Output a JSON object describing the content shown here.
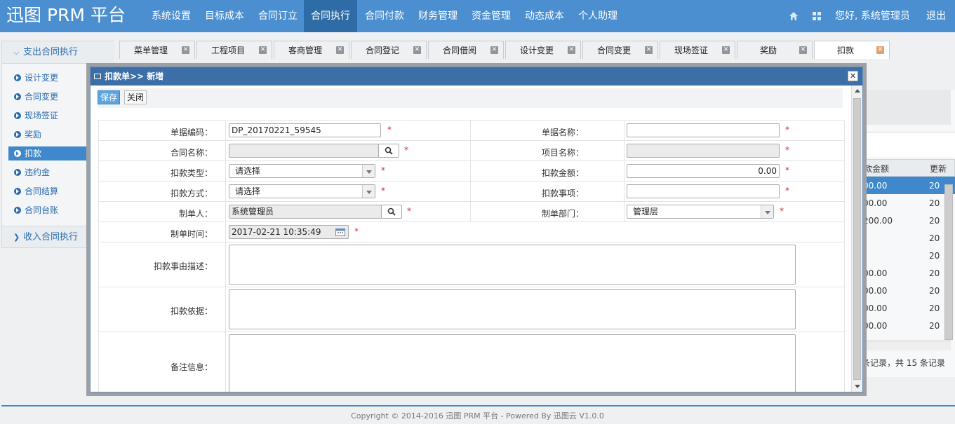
{
  "app": {
    "title": "迅图 PRM 平台"
  },
  "nav": {
    "items": [
      {
        "label": "系统设置"
      },
      {
        "label": "目标成本"
      },
      {
        "label": "合同订立"
      },
      {
        "label": "合同执行"
      },
      {
        "label": "合同付款"
      },
      {
        "label": "财务管理"
      },
      {
        "label": "资金管理"
      },
      {
        "label": "动态成本"
      },
      {
        "label": "个人助理"
      }
    ],
    "active": "合同执行",
    "greeting": "您好, 系统管理员",
    "logout": "退出"
  },
  "sidebar": {
    "group_label": "支出合同执行",
    "items": [
      {
        "label": "设计变更"
      },
      {
        "label": "合同变更"
      },
      {
        "label": "现场签证"
      },
      {
        "label": "奖励"
      },
      {
        "label": "扣款"
      },
      {
        "label": "违约金"
      },
      {
        "label": "合同结算"
      },
      {
        "label": "合同台账"
      }
    ],
    "active_item": "扣款",
    "income_label": "收入合同执行"
  },
  "tabs": [
    {
      "label": "菜单管理"
    },
    {
      "label": "工程项目"
    },
    {
      "label": "客商管理"
    },
    {
      "label": "合同登记"
    },
    {
      "label": "合同借阅"
    },
    {
      "label": "设计变更"
    },
    {
      "label": "合同变更"
    },
    {
      "label": "现场签证"
    },
    {
      "label": "奖励"
    },
    {
      "label": "扣款"
    }
  ],
  "background_grid": {
    "header_partial": "款金额",
    "header_next": "更新时",
    "rows": [
      {
        "amount": "00.00",
        "date": "20"
      },
      {
        "amount": "00.00",
        "date": "20"
      },
      {
        "amount": "200.00",
        "date": "20"
      },
      {
        "amount": "",
        "date": "20"
      },
      {
        "amount": "",
        "date": "20"
      },
      {
        "amount": "00.00",
        "date": "20"
      },
      {
        "amount": "00.00",
        "date": "20"
      },
      {
        "amount": "00.00",
        "date": "20"
      },
      {
        "amount": "00.00",
        "date": "20"
      }
    ],
    "pager_text": "条记录，共 15 条记录"
  },
  "modal": {
    "title": "扣款单>> 新增",
    "save_label": "保存",
    "close_label": "关闭",
    "fields": {
      "doc_code_label": "单据编码：",
      "doc_code_value": "DP_20170221_59545",
      "doc_name_label": "单据名称：",
      "doc_name_value": "",
      "contract_name_label": "合同名称：",
      "contract_name_value": "",
      "project_name_label": "项目名称：",
      "project_name_value": "",
      "deduction_type_label": "扣款类型：",
      "deduction_type_value": "请选择",
      "deduction_amount_label": "扣款金额：",
      "deduction_amount_value": "0.00",
      "deduction_method_label": "扣款方式：",
      "deduction_method_value": "请选择",
      "deduction_matter_label": "扣款事项：",
      "deduction_matter_value": "",
      "creator_label": "制单人：",
      "creator_value": "系统管理员",
      "creator_dept_label": "制单部门：",
      "creator_dept_value": "管理层",
      "create_time_label": "制单时间：",
      "create_time_value": "2017-02-21 10:35:49",
      "reason_label": "扣款事由描述：",
      "basis_label": "扣款依据：",
      "remarks_label": "备注信息："
    },
    "required_mark": "*"
  },
  "footer": {
    "text": "Copyright © 2014-2016 迅图 PRM 平台 - Powered By 迅图云 V1.0.0"
  },
  "colors": {
    "topbar": "#4b8fd0",
    "nav_active": "#2d6ca6",
    "modal_title": "#3c6fa8",
    "primary_btn": "#5aa4e0",
    "link": "#2a6cb0",
    "required": "#d03030"
  }
}
